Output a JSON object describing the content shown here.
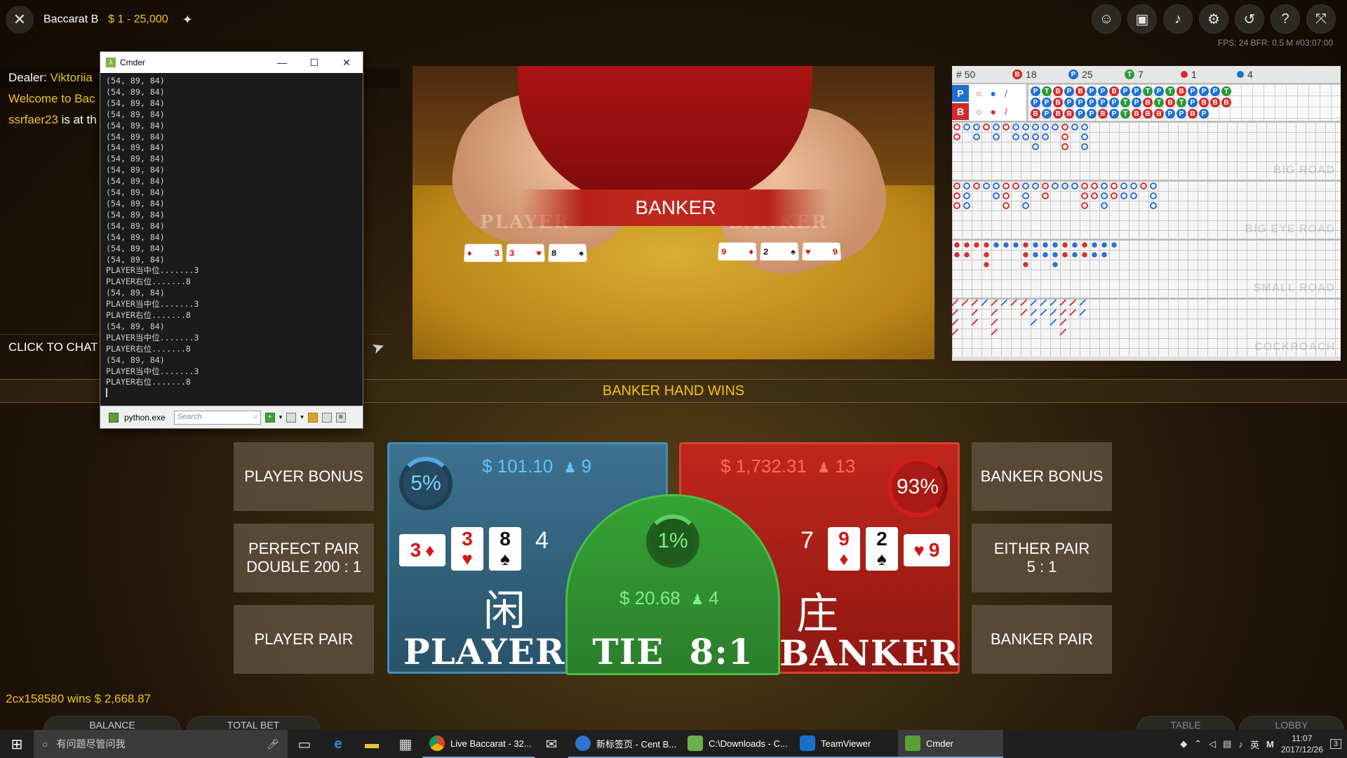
{
  "top": {
    "game_name": "Baccarat B",
    "limits": "$ 1 - 25,000",
    "fps_info": "FPS: 24 BFR: 0.5   M   #03:07:00"
  },
  "chat": {
    "dealer_label": "Dealer:",
    "dealer_name": "Viktoriia",
    "welcome": "Welcome to Bac",
    "user": "ssrfaer23",
    "user_msg": " is at th",
    "input_placeholder": "CLICK TO CHAT"
  },
  "cmder": {
    "title": "Cmder",
    "lines": [
      "(54, 89, 84)",
      "(54, 89, 84)",
      "(54, 89, 84)",
      "(54, 89, 84)",
      "(54, 89, 84)",
      "(54, 89, 84)",
      "(54, 89, 84)",
      "(54, 89, 84)",
      "(54, 89, 84)",
      "(54, 89, 84)",
      "(54, 89, 84)",
      "(54, 89, 84)",
      "(54, 89, 84)",
      "(54, 89, 84)",
      "(54, 89, 84)",
      "(54, 89, 84)",
      "(54, 89, 84)",
      "PLAYER当中位.......3",
      "PLAYER右位.......8",
      "(54, 89, 84)",
      "PLAYER当中位.......3",
      "PLAYER右位.......8",
      "(54, 89, 84)",
      "PLAYER当中位.......3",
      "PLAYER右位.......8",
      "(54, 89, 84)",
      "PLAYER当中位.......3",
      "PLAYER右位.......8"
    ],
    "process": "python.exe",
    "search_placeholder": "Search"
  },
  "video": {
    "banner": "BANKER",
    "felt_player": "PLAYER",
    "felt_banker": "BANKER",
    "player_cards": [
      "3",
      "3",
      "8"
    ],
    "banker_cards": [
      "9",
      "2",
      "9"
    ]
  },
  "roads": {
    "total": "# 50",
    "banker_count": "18",
    "player_count": "25",
    "tie_count": "7",
    "pp_count": "1",
    "bp_count": "4",
    "pred_p": "P",
    "pred_b": "B",
    "bead_row1": [
      "P",
      "T",
      "B",
      "P",
      "B",
      "P",
      "P",
      "B",
      "P",
      "P",
      "T",
      "P",
      "T",
      "B",
      "P",
      "P",
      "P",
      "T"
    ],
    "bead_row2": [
      "P",
      "P",
      "B",
      "P",
      "P",
      "P",
      "P",
      "P",
      "T",
      "P",
      "B",
      "T",
      "B",
      "T",
      "P",
      "B",
      "B",
      "B"
    ],
    "bead_row3": [
      "B",
      "P",
      "B",
      "B",
      "P",
      "P",
      "B",
      "P",
      "T",
      "B",
      "B",
      "B",
      "P",
      "P",
      "B",
      "P"
    ],
    "labels": {
      "big": "BIG ROAD",
      "eye": "BIG EYE ROAD",
      "small": "SMALL ROAD",
      "roach": "COCKROACH"
    }
  },
  "result": "BANKER HAND WINS",
  "bets": {
    "player_bonus": "PLAYER BONUS",
    "perfect_pair_1": "PERFECT PAIR",
    "perfect_pair_2": "DOUBLE 200 : 1",
    "player_pair": "PLAYER PAIR",
    "banker_bonus": "BANKER BONUS",
    "either_pair_1": "EITHER PAIR",
    "either_pair_2": "5 : 1",
    "banker_pair": "BANKER PAIR",
    "player": {
      "pct": "5%",
      "amount": "$ 101.10",
      "players": "9",
      "total": "4",
      "han": "闲",
      "name": "PLAYER",
      "cards": [
        {
          "rank": "3",
          "suit": "♥"
        },
        {
          "rank": "8",
          "suit": "♠"
        }
      ],
      "side_card": {
        "rank": "3",
        "suit": "♦"
      }
    },
    "banker": {
      "pct": "93%",
      "amount": "$ 1,732.31",
      "players": "13",
      "total": "7",
      "han": "庄",
      "name": "BANKER",
      "cards": [
        {
          "rank": "9",
          "suit": "♦"
        },
        {
          "rank": "2",
          "suit": "♠"
        }
      ],
      "side_card": {
        "rank": "9",
        "suit": "♥"
      }
    },
    "tie": {
      "pct": "1%",
      "amount": "$ 20.68",
      "players": "4",
      "name": "TIE",
      "odds": "8:1"
    }
  },
  "bottom": {
    "wins_ticker": "2cx158580 wins $ 2,668.87",
    "balance_label": "BALANCE",
    "total_bet_label": "TOTAL BET",
    "table_label": "TABLE",
    "lobby_label": "LOBBY"
  },
  "taskbar": {
    "search_placeholder": "有问题尽管问我",
    "apps": [
      "Live Baccarat - 32...",
      "新标签页 - Cent B...",
      "C:\\Downloads - C...",
      "TeamViewer",
      "Cmder"
    ],
    "ime": "英",
    "time": "11:07",
    "date": "2017/12/26",
    "notifications": "3"
  },
  "colors": {
    "accent_gold": "#f0c21a",
    "player_blue": "#3d8fc0",
    "banker_red": "#c0271c",
    "tie_green": "#35a335"
  }
}
